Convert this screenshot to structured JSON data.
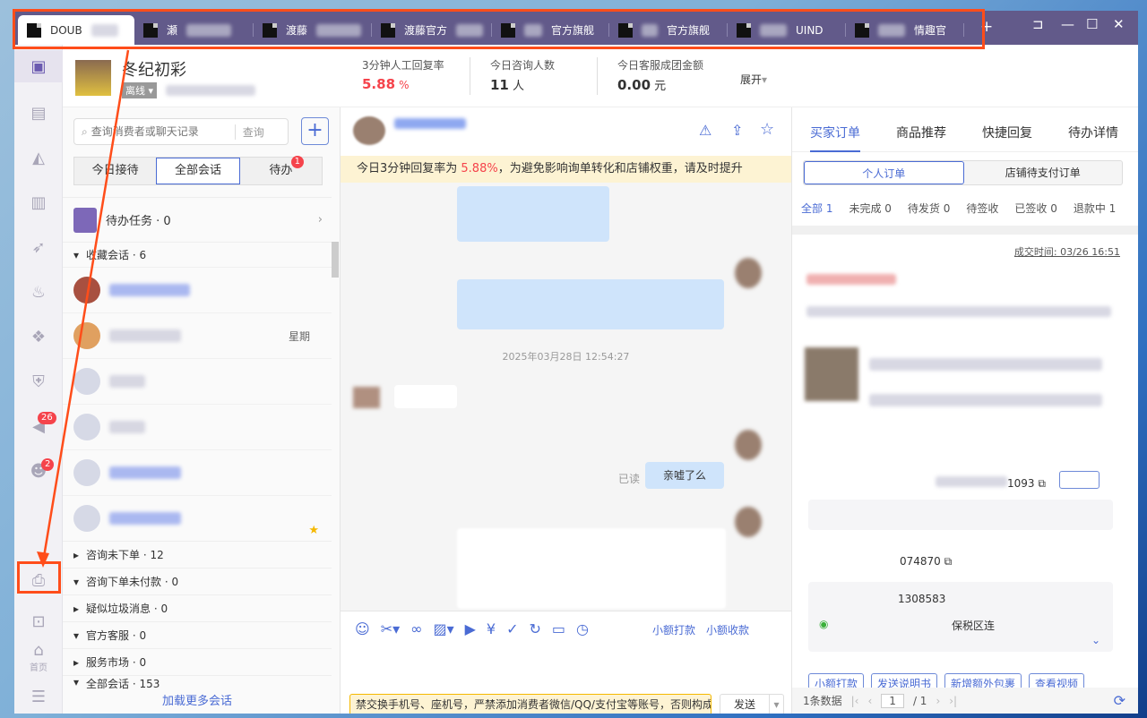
{
  "tabs": [
    {
      "label": "DOUB"
    },
    {
      "label": "瀬"
    },
    {
      "label": "渡藤"
    },
    {
      "label": "渡藤官方"
    },
    {
      "label": "官方旗舰"
    },
    {
      "label": "官方旗舰"
    },
    {
      "label": "UIND"
    },
    {
      "label": "情趣官"
    }
  ],
  "tab_add": "+",
  "window_controls": {
    "pin": "⊐",
    "min": "—",
    "max": "☐",
    "close": "✕"
  },
  "sidebar": {
    "badge_notify": "26",
    "badge_contacts": "2",
    "home_label": "首页"
  },
  "header": {
    "name": "冬纪初彩",
    "status": "离线",
    "stats": [
      {
        "label": "3分钟人工回复率",
        "value": "5.88",
        "unit": "%"
      },
      {
        "label": "今日咨询人数",
        "value": "11",
        "unit": "人"
      },
      {
        "label": "今日客服成团金额",
        "value": "0.00",
        "unit": "元"
      }
    ],
    "expand": "展开"
  },
  "list": {
    "search_placeholder": "查询消费者或聊天记录",
    "search_btn": "查询",
    "add": "+",
    "tabs": [
      "今日接待",
      "全部会话",
      "待办"
    ],
    "todo_badge": "1",
    "task": "待办任务 · 0",
    "fav_group": "收藏会话 · 6",
    "conv_time": "星期",
    "groups": [
      "咨询未下单 · 12",
      "咨询下单未付款 · 0",
      "疑似垃圾消息 · 0",
      "官方客服 · 0",
      "服务市场 · 0",
      "全部会话 · 153"
    ],
    "load_more": "加载更多会话"
  },
  "chat": {
    "notice_prefix": "今日3分钟回复率为 ",
    "notice_rate": "5.88%",
    "notice_suffix": "，为避免影响询单转化和店铺权重，请及时提升",
    "timestamp": "2025年03月28日 12:54:27",
    "read": "已读",
    "msg": "亲嘘了么",
    "toolbar_links": [
      "小额打款",
      "小额收款"
    ],
    "input": "禁交换手机号、座机号，严禁添加消费者微信/QQ/支付宝等账号，否则构成",
    "send": "发送"
  },
  "right": {
    "tabs": [
      "买家订单",
      "商品推荐",
      "快捷回复",
      "待办详情"
    ],
    "subtabs": [
      "个人订单",
      "店铺待支付订单"
    ],
    "filters": [
      "全部 1",
      "未完成 0",
      "待发货 0",
      "待签收",
      "已签收 0",
      "退款中 1"
    ],
    "deal_time": "成交时间: 03/26 16:51",
    "order_no": "1093",
    "order_no2": "074870",
    "phone": "1308583",
    "address": "保税区连",
    "actions": [
      "小额打款",
      "发送说明书",
      "新增额外包裹",
      "查看视频"
    ],
    "count": "1条数据",
    "page": "1",
    "total": "/ 1",
    "colors": {
      "accent": "#4a6bd4",
      "red": "#f5434b"
    }
  }
}
